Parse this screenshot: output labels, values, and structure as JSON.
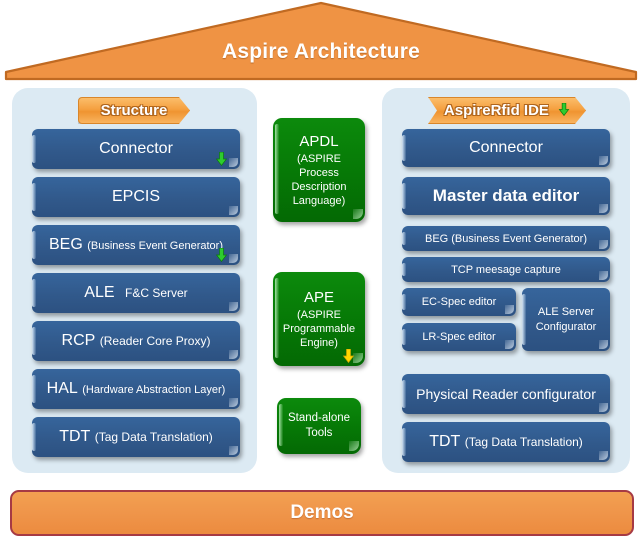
{
  "roof": {
    "title": "Aspire Architecture",
    "fill_color": "#ef9344",
    "stroke_color": "#c06a22"
  },
  "left_panel": {
    "header": {
      "label": "Structure",
      "color": "#f0a040"
    },
    "items": [
      {
        "acronym": "Connector",
        "detail": "",
        "style": "big",
        "arrow": "green"
      },
      {
        "acronym": "EPCIS",
        "detail": "",
        "style": "big",
        "arrow": "none"
      },
      {
        "acronym": "BEG",
        "detail": "(Business Event Generator)",
        "style": "acr",
        "arrow": "green"
      },
      {
        "acronym": "ALE",
        "detail": "F&C Server",
        "style": "acr",
        "arrow": "none"
      },
      {
        "acronym": "RCP",
        "detail": "(Reader Core Proxy)",
        "style": "acr",
        "arrow": "none"
      },
      {
        "acronym": "HAL",
        "detail": "(Hardware Abstraction Layer)",
        "style": "acr",
        "arrow": "none"
      },
      {
        "acronym": "TDT",
        "detail": "(Tag Data Translation)",
        "style": "acr",
        "arrow": "none"
      }
    ]
  },
  "middle_column": {
    "items": [
      {
        "title": "APDL",
        "subtitle": "(ASPIRE Process Description Language)",
        "arrow": "none"
      },
      {
        "title": "APE",
        "subtitle": "(ASPIRE Programmable Engine)",
        "arrow": "yellow"
      },
      {
        "title": "",
        "subtitle": "Stand-alone Tools",
        "arrow": "none"
      }
    ]
  },
  "right_panel": {
    "header": {
      "label": "AspireRfid IDE",
      "color": "#f0a040",
      "arrow": "green"
    },
    "items": [
      {
        "acronym": "Connector",
        "detail": "",
        "style": "big"
      },
      {
        "acronym": "Master data editor",
        "detail": "",
        "style": "bigb"
      },
      {
        "acronym": "BEG (Business Event Generator)",
        "detail": "",
        "style": "small"
      },
      {
        "acronym": "TCP meesage capture",
        "detail": "",
        "style": "small"
      }
    ],
    "split_row": {
      "left_items": [
        {
          "label": "EC-Spec editor"
        },
        {
          "label": "LR-Spec editor"
        }
      ],
      "right_item": {
        "label": "ALE Server Configurator"
      }
    },
    "items_bottom": [
      {
        "acronym": "Physical Reader configurator",
        "detail": "",
        "style": "mid"
      },
      {
        "acronym": "TDT",
        "detail": "(Tag Data Translation)",
        "style": "acr"
      }
    ]
  },
  "footer": {
    "label": "Demos",
    "fill_color": "#ef954a",
    "border_color": "#a63a44"
  },
  "icons": {
    "green_arrow": "arrow-down-green-icon",
    "yellow_arrow": "arrow-down-yellow-icon"
  }
}
